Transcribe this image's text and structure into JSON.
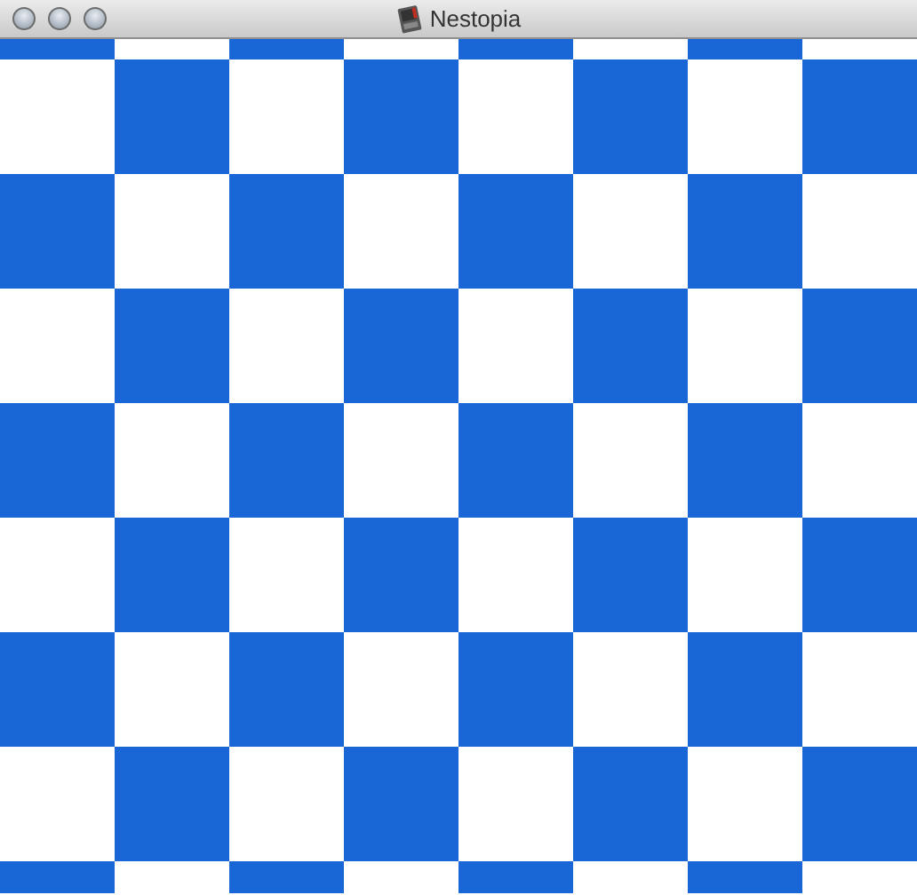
{
  "window": {
    "title": "Nestopia"
  }
}
